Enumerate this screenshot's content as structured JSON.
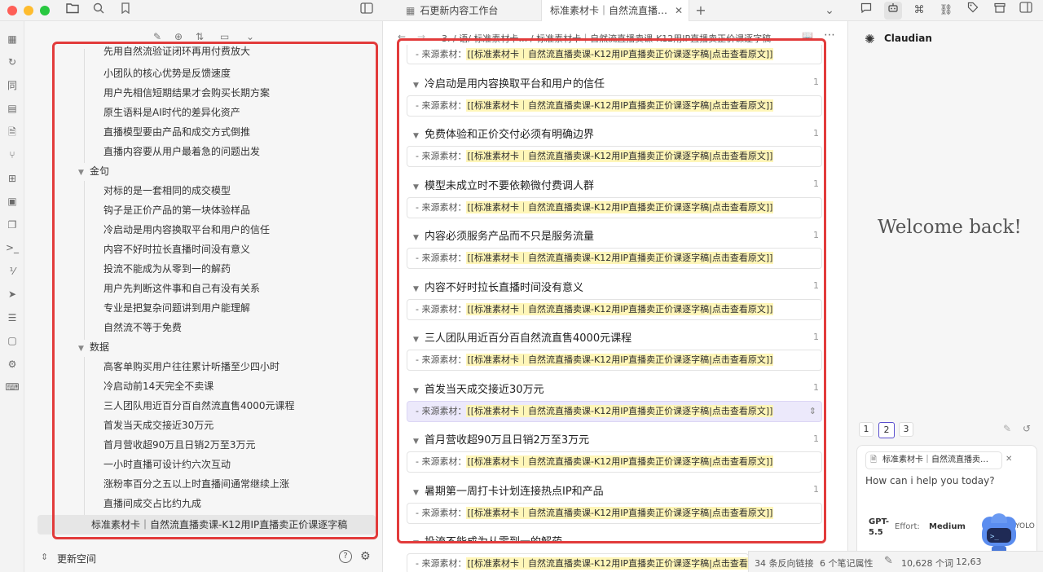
{
  "app": {
    "tabs": [
      {
        "label": "石更新内容工作台",
        "icon": "grid-icon"
      },
      {
        "label": "标准素材卡｜自然流直播…",
        "icon": ""
      }
    ],
    "new_tab": "+",
    "tab_list": "⌄"
  },
  "sidebar": {
    "top_item": "先用自然流验证闭环再用付费放大",
    "items_top": [
      "小团队的核心优势是反馈速度",
      "用户先相信短期结果才会购买长期方案",
      "原生语料是AI时代的差异化资产",
      "直播模型要由产品和成交方式倒推",
      "直播内容要从用户最着急的问题出发"
    ],
    "group_quotes": "金句",
    "items_quotes": [
      "对标的是一套相同的成交模型",
      "钩子是正价产品的第一块体验样品",
      "冷启动是用内容换取平台和用户的信任",
      "内容不好时拉长直播时间没有意义",
      "投流不能成为从零到一的解药",
      "用户先判断这件事和自己有没有关系",
      "专业是把复杂问题讲到用户能理解",
      "自然流不等于免费"
    ],
    "group_data": "数据",
    "items_data": [
      "高客单购买用户往往累计听播至少四小时",
      "冷启动前14天完全不卖课",
      "三人团队用近百分百自然流直售4000元课程",
      "首发当天成交接近30万元",
      "首月营收超90万且日销2万至3万元",
      "一小时直播可设计约六次互动",
      "涨粉率百分之五以上时直播间通常继续上涨",
      "直播间成交占比约九成"
    ],
    "selected_file": "标准素材卡｜自然流直播卖课-K12用IP直播卖正价课逐字稿",
    "vault_name": "更新空间"
  },
  "editor": {
    "breadcrumb": "3. / 语/ 标准素材卡… / 标准素材卡｜自然流直播卖课-K12用IP直播卖正价课逐字稿",
    "source_label": "- 来源素材：",
    "source_link": "[[标准素材卡｜自然流直播卖课-K12用IP直播卖正价课逐字稿|点击查看原文]]",
    "blocks": [
      {
        "heading": "冷启动是用内容换取平台和用户的信任",
        "count": "1"
      },
      {
        "heading": "免费体验和正价交付必须有明确边界",
        "count": "1"
      },
      {
        "heading": "模型未成立时不要依赖微付费调人群",
        "count": "1"
      },
      {
        "heading": "内容必须服务产品而不只是服务流量",
        "count": "1"
      },
      {
        "heading": "内容不好时拉长直播时间没有意义",
        "count": "1"
      },
      {
        "heading": "三人团队用近百分百自然流直售4000元课程",
        "count": "1"
      },
      {
        "heading": "首发当天成交接近30万元",
        "count": "1"
      },
      {
        "heading": "首月营收超90万且日销2万至3万元",
        "count": "1"
      },
      {
        "heading": "暑期第一周打卡计划连接热点IP和产品",
        "count": "1"
      },
      {
        "heading": "投流不能成为从零到一的解药",
        "count": ""
      }
    ]
  },
  "right_panel": {
    "title": "Claudian",
    "welcome": "Welcome back!",
    "tabs": [
      "1",
      "2",
      "3"
    ],
    "context_chip": "标准素材卡｜自然流直播卖…",
    "placeholder": "How can i help you today?",
    "model": "GPT-5.5",
    "effort_label": "Effort:",
    "effort_value": "Medium",
    "yolo": "YOLO"
  },
  "status": {
    "backlinks": "34 条反向链接",
    "props": "6 个笔记属性",
    "words": "10,628 个词",
    "chars": "12,63"
  }
}
